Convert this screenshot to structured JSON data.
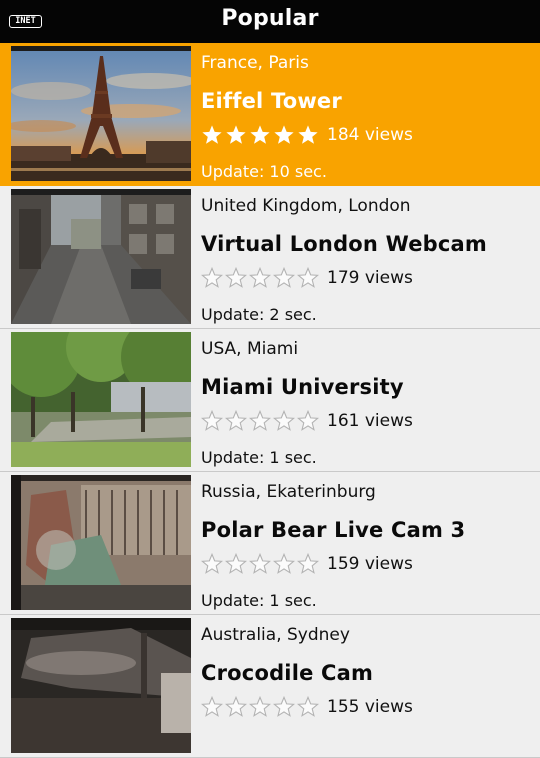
{
  "header": {
    "title": "Popular",
    "network_badge": "INET"
  },
  "colors": {
    "selected_bg": "#f9a300",
    "header_bg": "#050505",
    "row_bg": "#efefef"
  },
  "items": [
    {
      "location": "France, Paris",
      "name": "Eiffel Tower",
      "rating": 5,
      "views": "184 views",
      "update": "Update: 10 sec.",
      "selected": true,
      "thumbnail": "eiffel-tower"
    },
    {
      "location": "United Kingdom, London",
      "name": "Virtual London Webcam",
      "rating": 0,
      "views": "179 views",
      "update": "Update: 2 sec.",
      "selected": false,
      "thumbnail": "london-street"
    },
    {
      "location": "USA, Miami",
      "name": "Miami University",
      "rating": 0,
      "views": "161 views",
      "update": "Update: 1 sec.",
      "selected": false,
      "thumbnail": "miami-campus"
    },
    {
      "location": "Russia, Ekaterinburg",
      "name": "Polar Bear Live Cam 3",
      "rating": 0,
      "views": "159 views",
      "update": "Update: 1 sec.",
      "selected": false,
      "thumbnail": "polar-bear-enclosure"
    },
    {
      "location": "Australia, Sydney",
      "name": "Crocodile Cam",
      "rating": 0,
      "views": "155 views",
      "update": "",
      "selected": false,
      "thumbnail": "crocodile-pool"
    }
  ]
}
